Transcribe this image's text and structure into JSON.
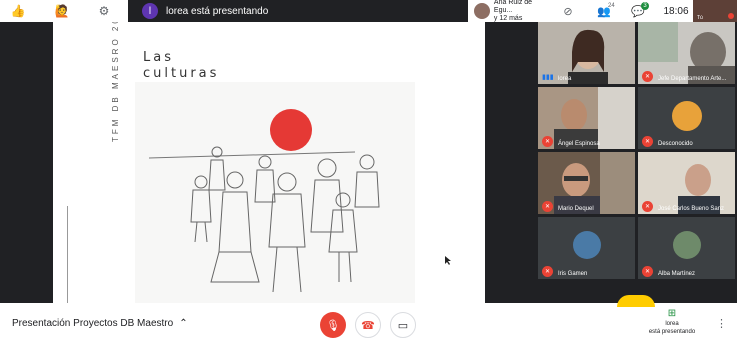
{
  "top": {
    "presenter_initial": "l",
    "presenting_text": "lorea está presentando",
    "attendee_name": "Ana Ruiz de Egu...",
    "attendee_more": "y 12 más",
    "people_count": "24",
    "chat_badge": "3",
    "time": "18:06",
    "self_label": "Tú"
  },
  "slide": {
    "side_text": "TFM DB MAESRO 2020",
    "title_line1": "Las",
    "title_line2": "culturas"
  },
  "participants": [
    {
      "name": "lorea"
    },
    {
      "name": "Jefe Departamento Arte..."
    },
    {
      "name": "Ángel Espinosa"
    },
    {
      "name": "Desconocido"
    },
    {
      "name": "Mario Dequel"
    },
    {
      "name": "José Carlos Bueno Sanz"
    },
    {
      "name": "Iris Gamen"
    },
    {
      "name": "Alba Martínez"
    }
  ],
  "bottom": {
    "meeting_title": "Presentación Proyectos DB Maestro",
    "presenting_name": "lorea",
    "presenting_label": "está presentando"
  },
  "colors": {
    "accent_red": "#ea4335",
    "sun_red": "#e53935",
    "presenter_purple": "#5e35b1",
    "present_green": "#1e8e3e",
    "dark_bg": "#202124"
  }
}
